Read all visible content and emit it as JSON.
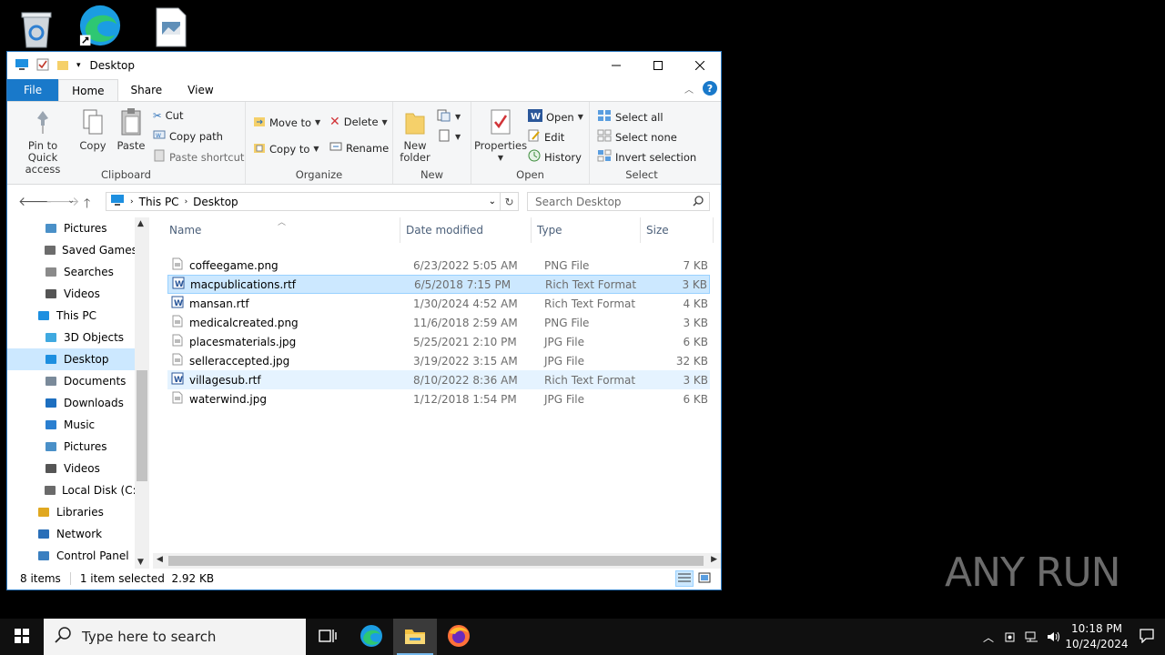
{
  "desktop": {
    "icons": [
      "recycle-bin-icon",
      "edge-shortcut-icon",
      "image-file-icon"
    ],
    "watermark": "ANY RUN"
  },
  "window": {
    "title": "Desktop",
    "controls": {
      "minimize": "─",
      "maximize": "☐",
      "close": "✕"
    }
  },
  "ribbon_tabs": {
    "file": "File",
    "home": "Home",
    "share": "Share",
    "view": "View",
    "help": "?"
  },
  "ribbon": {
    "clipboard": {
      "pin": "Pin to Quick access",
      "copy": "Copy",
      "paste": "Paste",
      "cut": "Cut",
      "copy_path": "Copy path",
      "paste_shortcut": "Paste shortcut",
      "label": "Clipboard"
    },
    "organize": {
      "move_to": "Move to",
      "copy_to": "Copy to",
      "delete": "Delete",
      "rename": "Rename",
      "label": "Organize"
    },
    "new": {
      "new_folder": "New folder",
      "label": "New"
    },
    "open": {
      "properties": "Properties",
      "open": "Open",
      "edit": "Edit",
      "history": "History",
      "label": "Open"
    },
    "select": {
      "select_all": "Select all",
      "select_none": "Select none",
      "invert": "Invert selection",
      "label": "Select"
    }
  },
  "address": {
    "crumb_1": "This PC",
    "crumb_2": "Desktop",
    "search_placeholder": "Search Desktop"
  },
  "nav": {
    "items": [
      {
        "label": "Pictures",
        "icon": "pictures-icon"
      },
      {
        "label": "Saved Games",
        "icon": "saved-games-icon"
      },
      {
        "label": "Searches",
        "icon": "searches-icon"
      },
      {
        "label": "Videos",
        "icon": "videos-icon"
      },
      {
        "label": "This PC",
        "icon": "this-pc-icon"
      },
      {
        "label": "3D Objects",
        "icon": "3d-objects-icon"
      },
      {
        "label": "Desktop",
        "icon": "desktop-icon"
      },
      {
        "label": "Documents",
        "icon": "documents-icon"
      },
      {
        "label": "Downloads",
        "icon": "downloads-icon"
      },
      {
        "label": "Music",
        "icon": "music-icon"
      },
      {
        "label": "Pictures",
        "icon": "pictures-icon"
      },
      {
        "label": "Videos",
        "icon": "videos-icon"
      },
      {
        "label": "Local Disk (C:)",
        "icon": "local-disk-icon"
      },
      {
        "label": "Libraries",
        "icon": "libraries-icon"
      },
      {
        "label": "Network",
        "icon": "network-icon"
      },
      {
        "label": "Control Panel",
        "icon": "control-panel-icon"
      }
    ]
  },
  "columns": {
    "name": "Name",
    "date": "Date modified",
    "type": "Type",
    "size": "Size"
  },
  "files": [
    {
      "name": "coffeegame.png",
      "date": "6/23/2022 5:05 AM",
      "type": "PNG File",
      "size": "7 KB"
    },
    {
      "name": "macpublications.rtf",
      "date": "6/5/2018 7:15 PM",
      "type": "Rich Text Format",
      "size": "3 KB"
    },
    {
      "name": "mansan.rtf",
      "date": "1/30/2024 4:52 AM",
      "type": "Rich Text Format",
      "size": "4 KB"
    },
    {
      "name": "medicalcreated.png",
      "date": "11/6/2018 2:59 AM",
      "type": "PNG File",
      "size": "3 KB"
    },
    {
      "name": "placesmaterials.jpg",
      "date": "5/25/2021 2:10 PM",
      "type": "JPG File",
      "size": "6 KB"
    },
    {
      "name": "selleraccepted.jpg",
      "date": "3/19/2022 3:15 AM",
      "type": "JPG File",
      "size": "32 KB"
    },
    {
      "name": "villagesub.rtf",
      "date": "8/10/2022 8:36 AM",
      "type": "Rich Text Format",
      "size": "3 KB"
    },
    {
      "name": "waterwind.jpg",
      "date": "1/12/2018 1:54 PM",
      "type": "JPG File",
      "size": "6 KB"
    }
  ],
  "status": {
    "count": "8 items",
    "selection": "1 item selected  2.92 KB"
  },
  "taskbar": {
    "search_placeholder": "Type here to search",
    "time": "10:18 PM",
    "date": "10/24/2024"
  },
  "colors": {
    "accent": "#1979ca",
    "selection": "#cce8ff",
    "hover": "#e5f3ff"
  }
}
